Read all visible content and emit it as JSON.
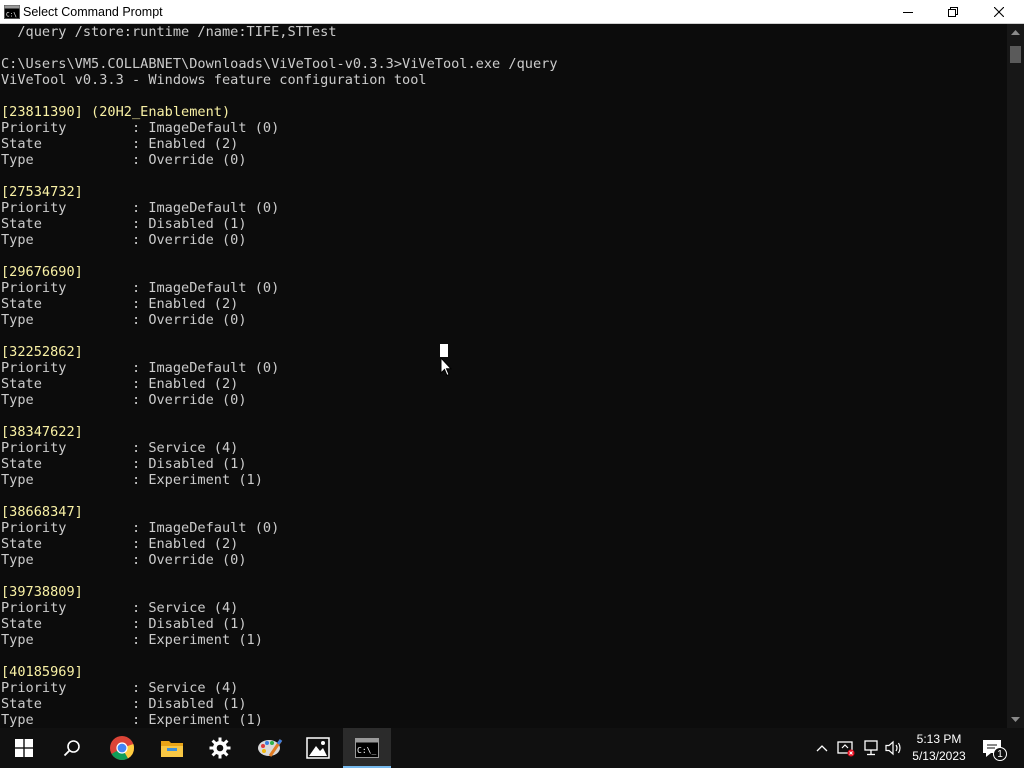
{
  "window": {
    "title": "Select Command Prompt",
    "icon": "cmd-icon"
  },
  "console": {
    "lines": [
      {
        "text": "  /query /store:runtime /name:TIFE,STTest",
        "hl": false
      },
      {
        "text": "",
        "hl": false
      },
      {
        "text": "C:\\Users\\VM5.COLLABNET\\Downloads\\ViVeTool-v0.3.3>ViVeTool.exe /query",
        "hl": false
      },
      {
        "text": "ViVeTool v0.3.3 - Windows feature configuration tool",
        "hl": false
      },
      {
        "text": "",
        "hl": false
      },
      {
        "text": "[23811390] (20H2_Enablement)",
        "hl": true
      },
      {
        "text": "Priority        : ImageDefault (0)",
        "hl": false
      },
      {
        "text": "State           : Enabled (2)",
        "hl": false
      },
      {
        "text": "Type            : Override (0)",
        "hl": false
      },
      {
        "text": "",
        "hl": false
      },
      {
        "text": "[27534732]",
        "hl": true
      },
      {
        "text": "Priority        : ImageDefault (0)",
        "hl": false
      },
      {
        "text": "State           : Disabled (1)",
        "hl": false
      },
      {
        "text": "Type            : Override (0)",
        "hl": false
      },
      {
        "text": "",
        "hl": false
      },
      {
        "text": "[29676690]",
        "hl": true
      },
      {
        "text": "Priority        : ImageDefault (0)",
        "hl": false
      },
      {
        "text": "State           : Enabled (2)",
        "hl": false
      },
      {
        "text": "Type            : Override (0)",
        "hl": false
      },
      {
        "text": "",
        "hl": false
      },
      {
        "text": "[32252862]",
        "hl": true
      },
      {
        "text": "Priority        : ImageDefault (0)",
        "hl": false
      },
      {
        "text": "State           : Enabled (2)",
        "hl": false
      },
      {
        "text": "Type            : Override (0)",
        "hl": false
      },
      {
        "text": "",
        "hl": false
      },
      {
        "text": "[38347622]",
        "hl": true
      },
      {
        "text": "Priority        : Service (4)",
        "hl": false
      },
      {
        "text": "State           : Disabled (1)",
        "hl": false
      },
      {
        "text": "Type            : Experiment (1)",
        "hl": false
      },
      {
        "text": "",
        "hl": false
      },
      {
        "text": "[38668347]",
        "hl": true
      },
      {
        "text": "Priority        : ImageDefault (0)",
        "hl": false
      },
      {
        "text": "State           : Enabled (2)",
        "hl": false
      },
      {
        "text": "Type            : Override (0)",
        "hl": false
      },
      {
        "text": "",
        "hl": false
      },
      {
        "text": "[39738809]",
        "hl": true
      },
      {
        "text": "Priority        : Service (4)",
        "hl": false
      },
      {
        "text": "State           : Disabled (1)",
        "hl": false
      },
      {
        "text": "Type            : Experiment (1)",
        "hl": false
      },
      {
        "text": "",
        "hl": false
      },
      {
        "text": "[40185969]",
        "hl": true
      },
      {
        "text": "Priority        : Service (4)",
        "hl": false
      },
      {
        "text": "State           : Disabled (1)",
        "hl": false
      },
      {
        "text": "Type            : Experiment (1)",
        "hl": false
      }
    ],
    "colors": {
      "background": "#0c0c0c",
      "text": "#cccccc",
      "highlight": "#f9f1a5"
    }
  },
  "taskbar": {
    "items": [
      "start-icon",
      "search-icon",
      "chrome-icon",
      "file-explorer-icon",
      "settings-icon",
      "paint-icon",
      "photos-icon",
      "command-prompt-icon"
    ],
    "active": "command-prompt-icon",
    "tray": [
      "chevron-up-icon",
      "security-icon",
      "network-icon",
      "volume-icon"
    ],
    "time": "5:13 PM",
    "date": "5/13/2023",
    "notification_count": "1"
  }
}
